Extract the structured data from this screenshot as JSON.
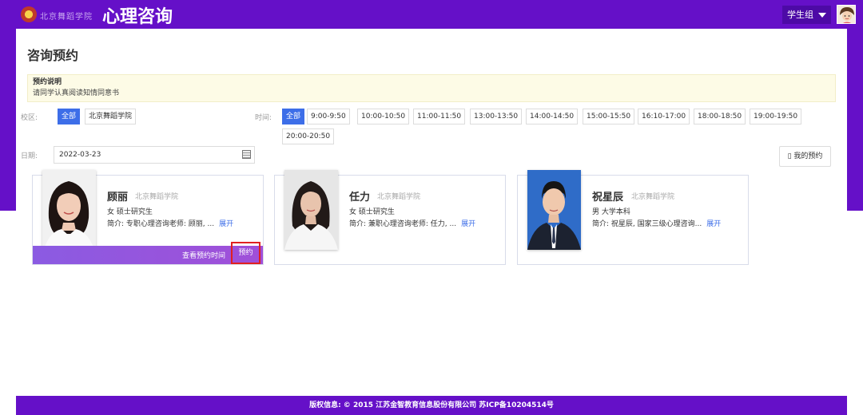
{
  "header": {
    "logo_text": "北京舞蹈学院",
    "app_title": "心理咨询",
    "user_group": "学生组"
  },
  "page": {
    "title": "咨询预约",
    "notice_title": "预约说明",
    "notice_text": "请同学认真阅读知情同意书"
  },
  "filters": {
    "campus_label": "校区:",
    "campus_options": [
      "全部",
      "北京舞蹈学院"
    ],
    "campus_selected": "全部",
    "time_label": "时间:",
    "time_options": [
      "全部",
      "9:00-9:50",
      "10:00-10:50",
      "11:00-11:50",
      "13:00-13:50",
      "14:00-14:50",
      "15:00-15:50",
      "16:10-17:00",
      "18:00-18:50",
      "19:00-19:50",
      "20:00-20:50"
    ],
    "time_selected": "全部",
    "date_label": "日期:",
    "date_value": "2022-03-23"
  },
  "my_appointments_label": "▯ 我的预约",
  "counselors": [
    {
      "name": "顾丽",
      "college": "北京舞蹈学院",
      "info": "女 硕士研究生",
      "intro": "简介: 专职心理咨询老师: 顾丽, ...",
      "expand_label": "展开",
      "view_time_label": "查看预约时间",
      "book_label": "预约"
    },
    {
      "name": "任力",
      "college": "北京舞蹈学院",
      "info": "女 硕士研究生",
      "intro": "简介: 兼职心理咨询老师: 任力, ...",
      "expand_label": "展开"
    },
    {
      "name": "祝星辰",
      "college": "北京舞蹈学院",
      "info": "男 大学本科",
      "intro": "简介: 祝星辰, 国家三级心理咨询...",
      "expand_label": "展开"
    }
  ],
  "footer": {
    "text": "版权信息: © 2015 江苏金智教育信息股份有限公司 苏ICP备10204514号"
  },
  "colors": {
    "brand_purple": "#6510c8",
    "accent_blue": "#3d6ee8",
    "highlight_red": "#e02020"
  }
}
